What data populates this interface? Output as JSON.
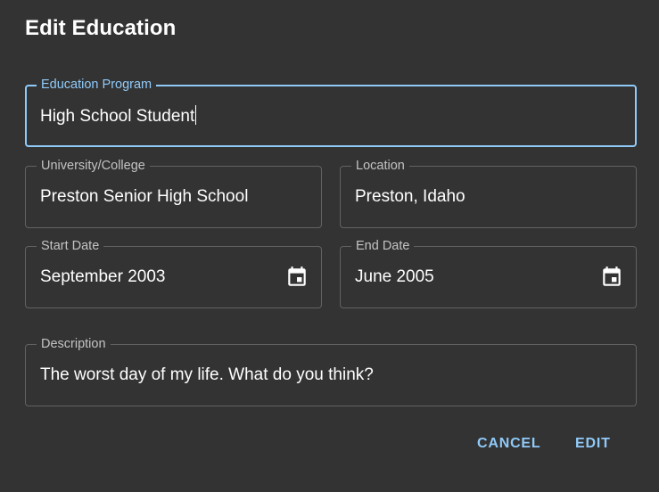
{
  "dialog": {
    "title": "Edit Education"
  },
  "fields": {
    "program": {
      "label": "Education Program",
      "value": "High School Student"
    },
    "university": {
      "label": "University/College",
      "value": "Preston Senior High School"
    },
    "location": {
      "label": "Location",
      "value": "Preston, Idaho"
    },
    "start_date": {
      "label": "Start Date",
      "value": "September 2003",
      "icon": "calendar-icon"
    },
    "end_date": {
      "label": "End Date",
      "value": "June 2005",
      "icon": "calendar-icon"
    },
    "description": {
      "label": "Description",
      "value": "The worst day of my life. What do you think?"
    }
  },
  "actions": {
    "cancel_label": "CANCEL",
    "edit_label": "EDIT"
  },
  "colors": {
    "background": "#333333",
    "accent": "#90caf9",
    "text": "#ffffff",
    "border": "rgba(255,255,255,0.23)"
  }
}
